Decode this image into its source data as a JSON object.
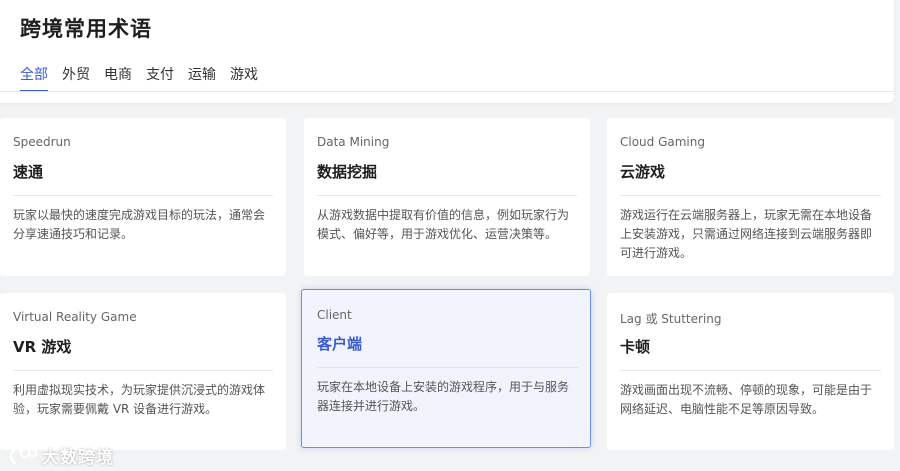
{
  "header": {
    "title": "跨境常用术语",
    "tabs": [
      {
        "label": "全部",
        "active": true
      },
      {
        "label": "外贸",
        "active": false
      },
      {
        "label": "电商",
        "active": false
      },
      {
        "label": "支付",
        "active": false
      },
      {
        "label": "运输",
        "active": false
      },
      {
        "label": "游戏",
        "active": false
      }
    ]
  },
  "colors": {
    "accent": "#3a5ccc",
    "highlight_bg": "#f1f4fd",
    "highlight_border": "#6f8de6"
  },
  "cards": [
    {
      "en": "Speedrun",
      "zh": "速通",
      "desc": "玩家以最快的速度完成游戏目标的玩法，通常会分享速通技巧和记录。",
      "highlighted": false
    },
    {
      "en": "Data Mining",
      "zh": "数据挖掘",
      "desc": "从游戏数据中提取有价值的信息，例如玩家行为模式、偏好等，用于游戏优化、运营决策等。",
      "highlighted": false
    },
    {
      "en": "Cloud Gaming",
      "zh": "云游戏",
      "desc": "游戏运行在云端服务器上，玩家无需在本地设备上安装游戏，只需通过网络连接到云端服务器即可进行游戏。",
      "highlighted": false
    },
    {
      "en": "Virtual Reality Game",
      "zh": "VR 游戏",
      "desc": "利用虚拟现实技术，为玩家提供沉浸式的游戏体验，玩家需要佩戴 VR 设备进行游戏。",
      "highlighted": false
    },
    {
      "en": "Client",
      "zh": "客户端",
      "desc": "玩家在本地设备上安装的游戏程序，用于与服务器连接并进行游戏。",
      "highlighted": true
    },
    {
      "en": "Lag 或 Stuttering",
      "zh": "卡顿",
      "desc": "游戏画面出现不流畅、停顿的现象，可能是由于网络延迟、电脑性能不足等原因导致。",
      "highlighted": false
    }
  ],
  "watermark": {
    "text": "大数跨境",
    "icon": "brand-logo-icon"
  }
}
